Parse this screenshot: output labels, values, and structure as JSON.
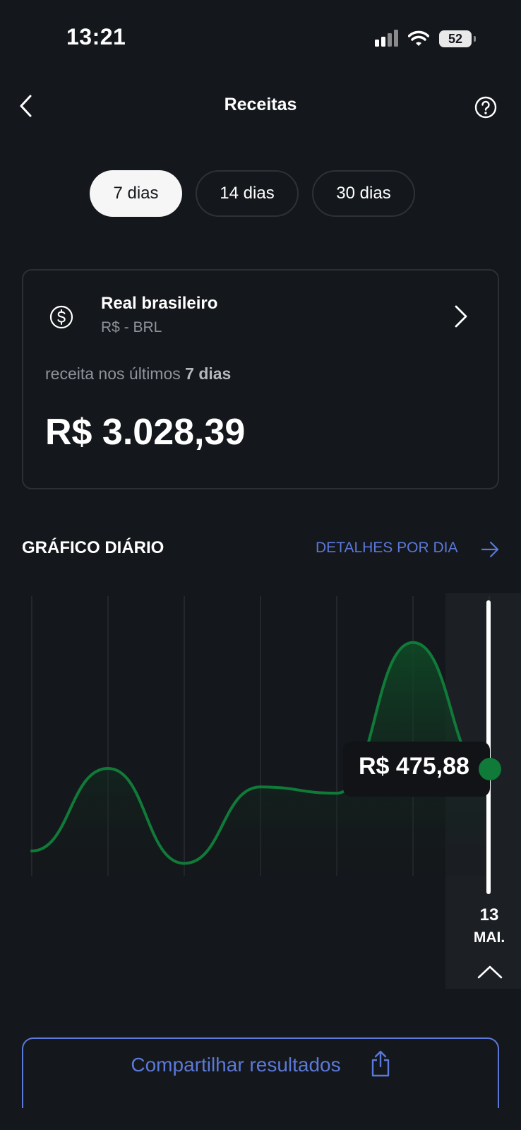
{
  "status_bar": {
    "time": "13:21",
    "battery": "52"
  },
  "header": {
    "title": "Receitas"
  },
  "periods": [
    {
      "label": "7 dias",
      "active": true
    },
    {
      "label": "14 dias",
      "active": false
    },
    {
      "label": "30 dias",
      "active": false
    }
  ],
  "card": {
    "currency_name": "Real brasileiro",
    "currency_code": "R$ - BRL",
    "label_prefix": "receita nos últimos ",
    "label_bold": "7 dias",
    "amount": "R$ 3.028,39"
  },
  "section": {
    "title": "GRÁFICO DIÁRIO",
    "link": "DETALHES POR DIA"
  },
  "chart_data": {
    "type": "area",
    "series": [
      {
        "values": [
          120,
          520,
          60,
          430,
          400,
          1130,
          475.88
        ]
      }
    ],
    "ylim": [
      0,
      1300
    ],
    "grid": true,
    "selected": {
      "value_label": "R$ 475,88",
      "day": "13",
      "month": "MAI."
    }
  },
  "share": {
    "label": "Compartilhar resultados"
  },
  "colors": {
    "accent": "#5b79d9",
    "positive": "#107a38",
    "background": "#14171b"
  }
}
